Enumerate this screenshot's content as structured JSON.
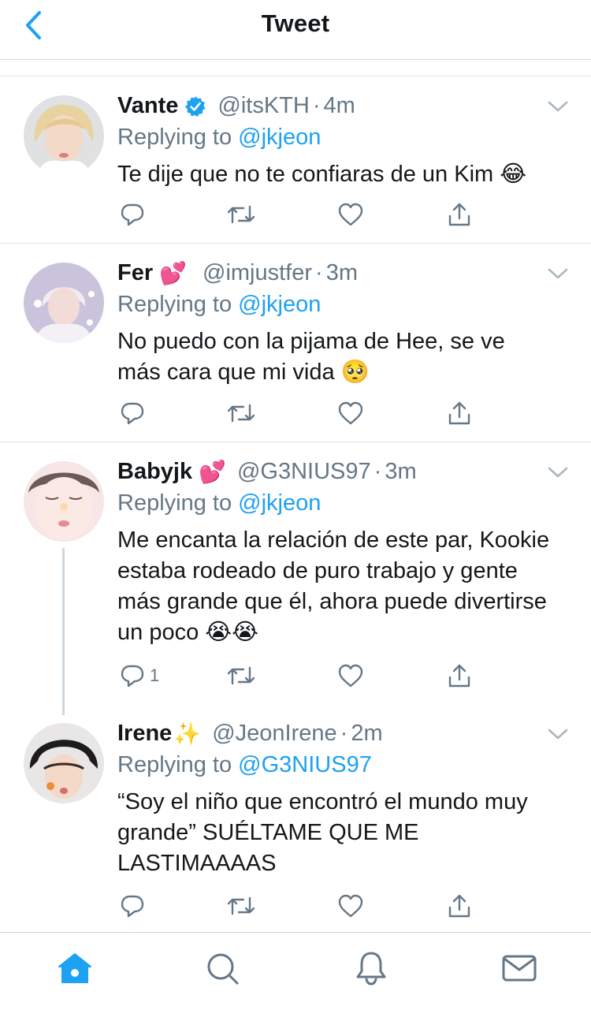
{
  "header": {
    "title": "Tweet"
  },
  "colors": {
    "accent": "#1da1f2",
    "muted": "#657786",
    "text": "#14171a",
    "heart_emoji": "#f2429b"
  },
  "tweets": [
    {
      "name": "Vante",
      "verified": true,
      "name_emoji": "",
      "handle": "@itsKTH",
      "time": "4m",
      "replying_prefix": "Replying to ",
      "replying_to": "@jkjeon",
      "text": "Te dije que no te confiaras de un Kim 😂",
      "reply_count": ""
    },
    {
      "name": "Fer",
      "verified": false,
      "name_emoji": "💕",
      "handle": "@imjustfer",
      "time": "3m",
      "replying_prefix": "Replying to ",
      "replying_to": "@jkjeon",
      "text": "No puedo con la pijama de Hee, se ve más cara que mi vida 🥺",
      "reply_count": ""
    },
    {
      "name": "Babyjk",
      "verified": false,
      "name_emoji": "💕",
      "handle": "@G3NIUS97",
      "time": "3m",
      "replying_prefix": "Replying to ",
      "replying_to": "@jkjeon",
      "text": "Me encanta la relación de este par, Kookie estaba rodeado de puro trabajo y gente más grande que él, ahora puede divertirse un poco 😭😭",
      "reply_count": "1"
    },
    {
      "name": "Irene",
      "verified": false,
      "name_emoji": "✨",
      "handle": "@JeonIrene",
      "time": "2m",
      "replying_prefix": "Replying to ",
      "replying_to": "@G3NIUS97",
      "text": "“Soy el niño que encontró el mundo muy grande” SUÉLTAME QUE ME LASTIMAAAAS",
      "reply_count": ""
    }
  ],
  "action_icons": [
    "reply-icon",
    "retweet-icon",
    "like-icon",
    "share-icon"
  ],
  "tabs": [
    "home-icon",
    "search-icon",
    "notifications-icon",
    "messages-icon"
  ]
}
